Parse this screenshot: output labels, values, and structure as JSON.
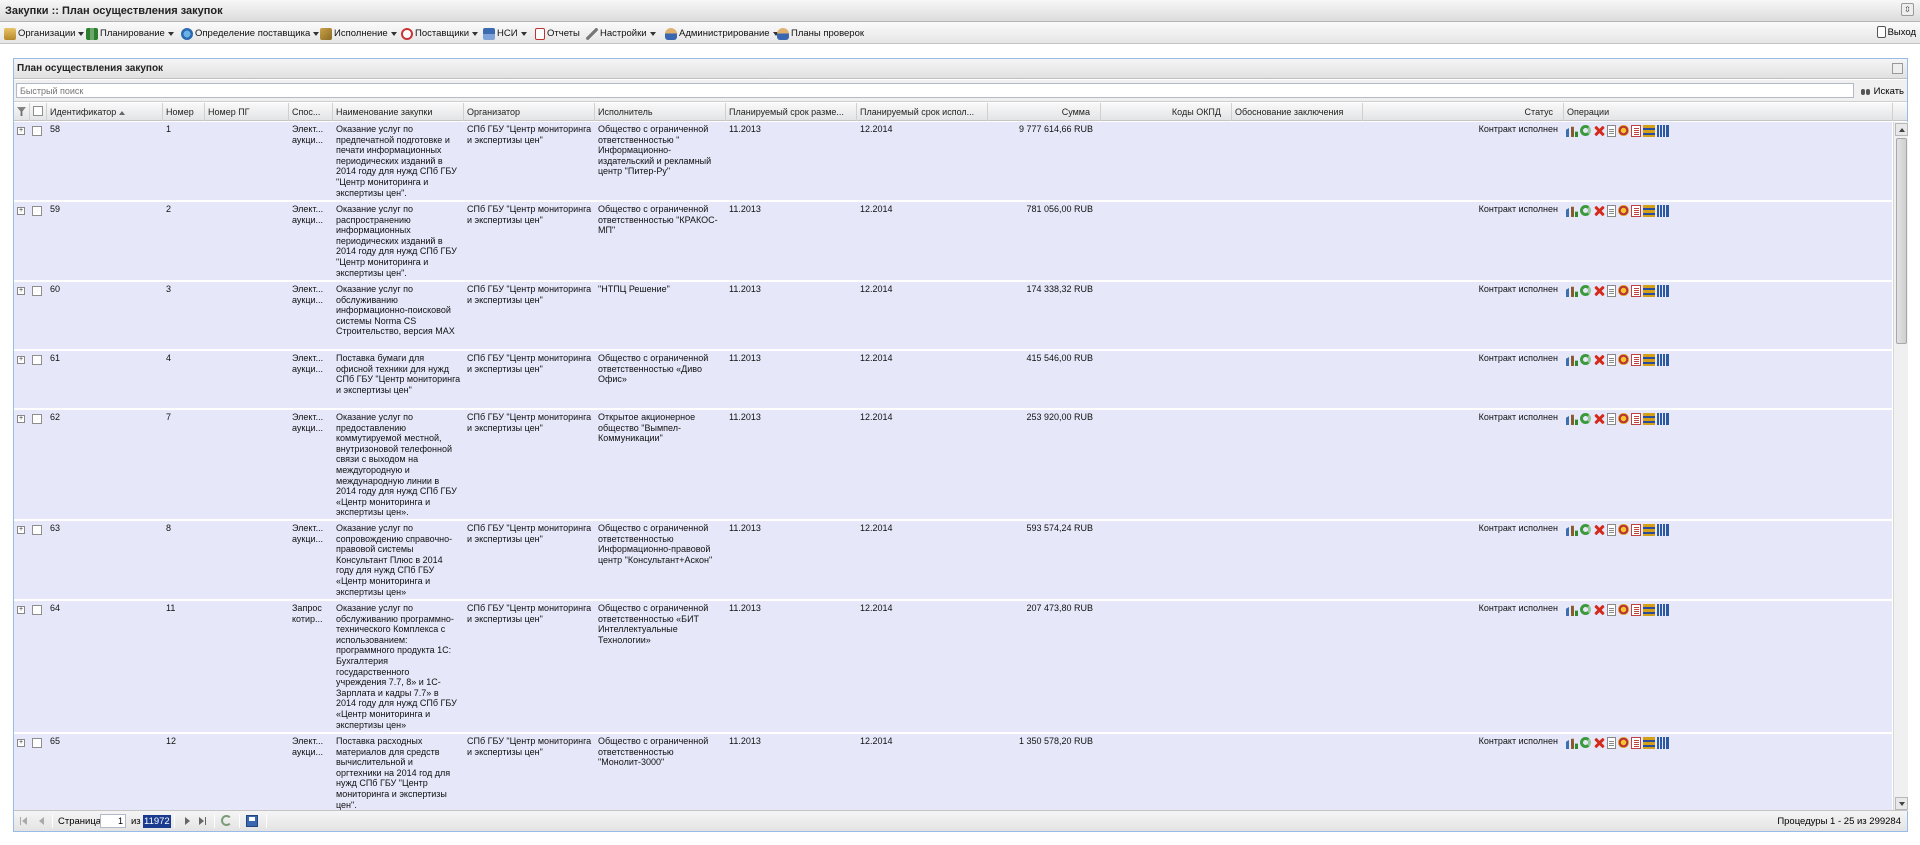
{
  "window": {
    "title": "Закупки :: План осуществления закупок"
  },
  "menu": {
    "items": [
      {
        "label": "Организации",
        "icon": "organizations-icon"
      },
      {
        "label": "Планирование",
        "icon": "planning-icon"
      },
      {
        "label": "Определение поставщика",
        "icon": "supplier-selection-icon"
      },
      {
        "label": "Исполнение",
        "icon": "execution-icon"
      },
      {
        "label": "Поставщики",
        "icon": "suppliers-icon"
      },
      {
        "label": "НСИ",
        "icon": "reference-data-icon"
      },
      {
        "label": "Отчеты",
        "icon": "reports-icon"
      },
      {
        "label": "Настройки",
        "icon": "settings-icon"
      },
      {
        "label": "Администрирование",
        "icon": "administration-icon"
      },
      {
        "label": "Планы проверок",
        "icon": "inspection-plans-icon"
      }
    ],
    "logout_label": "Выход"
  },
  "panel": {
    "title": "План осуществления закупок"
  },
  "search": {
    "placeholder": "Быстрый поиск",
    "button_label": "Искать"
  },
  "grid": {
    "columns": [
      "Идентификатор",
      "Номер",
      "Номер ПГ",
      "Спос...",
      "Наименование закупки",
      "Организатор",
      "Исполнитель",
      "Планируемый срок разме...",
      "Планируемый срок испол...",
      "Сумма",
      "Коды ОКПД",
      "Обоснование заключения",
      "Статус",
      "Операции"
    ],
    "rows": [
      {
        "id": "58",
        "num": "1",
        "pg": "",
        "method": "Элект... аукци...",
        "name": "Оказание услуг по предпечатной подготовке и печати информационных периодических изданий в 2014 году для нужд СПб ГБУ \"Центр мониторинга и экспертизы цен\".",
        "organizer": "СПб ГБУ \"Центр мониторинга и экспертизы цен\"",
        "executor": "Общество с ограниченной ответственностью \" Информационно-издательский и рекламный центр \"Питер-Ру\"",
        "plan_place": "11.2013",
        "plan_exec": "12.2014",
        "sum": "9 777 614,66 RUB",
        "okpd": "",
        "basis": "",
        "status": "Контракт исполнен"
      },
      {
        "id": "59",
        "num": "2",
        "pg": "",
        "method": "Элект... аукци...",
        "name": "Оказание услуг по распространению информационных периодических изданий в 2014 году для нужд СПб ГБУ \"Центр мониторинга и экспертизы цен\".",
        "organizer": "СПб ГБУ \"Центр мониторинга и экспертизы цен\"",
        "executor": "Общество с ограниченной ответственностью \"КРАКОС-МП\"",
        "plan_place": "11.2013",
        "plan_exec": "12.2014",
        "sum": "781 056,00 RUB",
        "okpd": "",
        "basis": "",
        "status": "Контракт исполнен"
      },
      {
        "id": "60",
        "num": "3",
        "pg": "",
        "method": "Элект... аукци...",
        "name": "Оказание услуг по обслуживанию информационно-поисковой системы Norma CS Строительство, версия MAX",
        "organizer": "СПб ГБУ \"Центр мониторинга и экспертизы цен\"",
        "executor": "\"НТПЦ Решение\"",
        "plan_place": "11.2013",
        "plan_exec": "12.2014",
        "sum": "174 338,32 RUB",
        "okpd": "",
        "basis": "",
        "status": "Контракт исполнен"
      },
      {
        "id": "61",
        "num": "4",
        "pg": "",
        "method": "Элект... аукци...",
        "name": "Поставка бумаги для офисной техники для нужд СПб ГБУ \"Центр мониторинга и экспертизы цен\"",
        "organizer": "СПб ГБУ \"Центр мониторинга и экспертизы цен\"",
        "executor": "Общество с ограниченной ответственностью «Диво Офис»",
        "plan_place": "11.2013",
        "plan_exec": "12.2014",
        "sum": "415 546,00 RUB",
        "okpd": "",
        "basis": "",
        "status": "Контракт исполнен"
      },
      {
        "id": "62",
        "num": "7",
        "pg": "",
        "method": "Элект... аукци...",
        "name": "Оказание услуг по предоставлению коммутируемой местной, внутризоновой телефонной связи с выходом на междугородную и международную линии в 2014 году для нужд СПб ГБУ «Центр мониторинга и экспертизы цен».",
        "organizer": "СПб ГБУ \"Центр мониторинга и экспертизы цен\"",
        "executor": "Открытое акционерное общество \"Вымпел-Коммуникации\"",
        "plan_place": "11.2013",
        "plan_exec": "12.2014",
        "sum": "253 920,00 RUB",
        "okpd": "",
        "basis": "",
        "status": "Контракт исполнен"
      },
      {
        "id": "63",
        "num": "8",
        "pg": "",
        "method": "Элект... аукци...",
        "name": "Оказание услуг по сопровождению справочно-правовой системы Консультант Плюс в 2014 году для нужд СПб ГБУ «Центр мониторинга и экспертизы цен»",
        "organizer": "СПб ГБУ \"Центр мониторинга и экспертизы цен\"",
        "executor": "Общество с ограниченной ответственностью Информационно-правовой центр \"Консультант+Аскон\"",
        "plan_place": "11.2013",
        "plan_exec": "12.2014",
        "sum": "593 574,24 RUB",
        "okpd": "",
        "basis": "",
        "status": "Контракт исполнен"
      },
      {
        "id": "64",
        "num": "11",
        "pg": "",
        "method": "Запрос котир...",
        "name": "Оказание услуг по обслуживанию программно-технического Комплекса с использованием: программного продукта 1С: Бухгалтерия государственного учреждения 7.7, 8» и 1С-Зарплата и кадры 7.7» в 2014 году для нужд СПб ГБУ «Центр мониторинга и экспертизы цен»",
        "organizer": "СПб ГБУ \"Центр мониторинга и экспертизы цен\"",
        "executor": "Общество с ограниченной ответственностью «БИТ Интеллектуальные Технологии»",
        "plan_place": "11.2013",
        "plan_exec": "12.2014",
        "sum": "207 473,80 RUB",
        "okpd": "",
        "basis": "",
        "status": "Контракт исполнен"
      },
      {
        "id": "65",
        "num": "12",
        "pg": "",
        "method": "Элект... аукци...",
        "name": "Поставка расходных материалов для средств вычислительной и оргтехники на 2014 год для нужд СПб ГБУ \"Центр мониторинга и экспертизы цен\".",
        "organizer": "СПб ГБУ \"Центр мониторинга и экспертизы цен\"",
        "executor": "Общество с ограниченной ответственностью \"Монолит-3000\"",
        "plan_place": "11.2013",
        "plan_exec": "12.2014",
        "sum": "1 350 578,20 RUB",
        "okpd": "",
        "basis": "",
        "status": "Контракт исполнен"
      }
    ],
    "row_operations": [
      "chart-icon",
      "refresh-icon",
      "delete-icon",
      "document-icon",
      "emblem-icon",
      "list-icon",
      "stack-icon",
      "bars-icon"
    ]
  },
  "paging": {
    "page_label": "Страница",
    "current_page": "1",
    "of_label": "из",
    "total_pages": "11972",
    "summary": "Процедуры 1 - 25 из 299284"
  },
  "colors": {
    "row_bg": "#e6e8fa",
    "header_bg": "#e3e4e6",
    "accent": "#1a3a8f"
  }
}
